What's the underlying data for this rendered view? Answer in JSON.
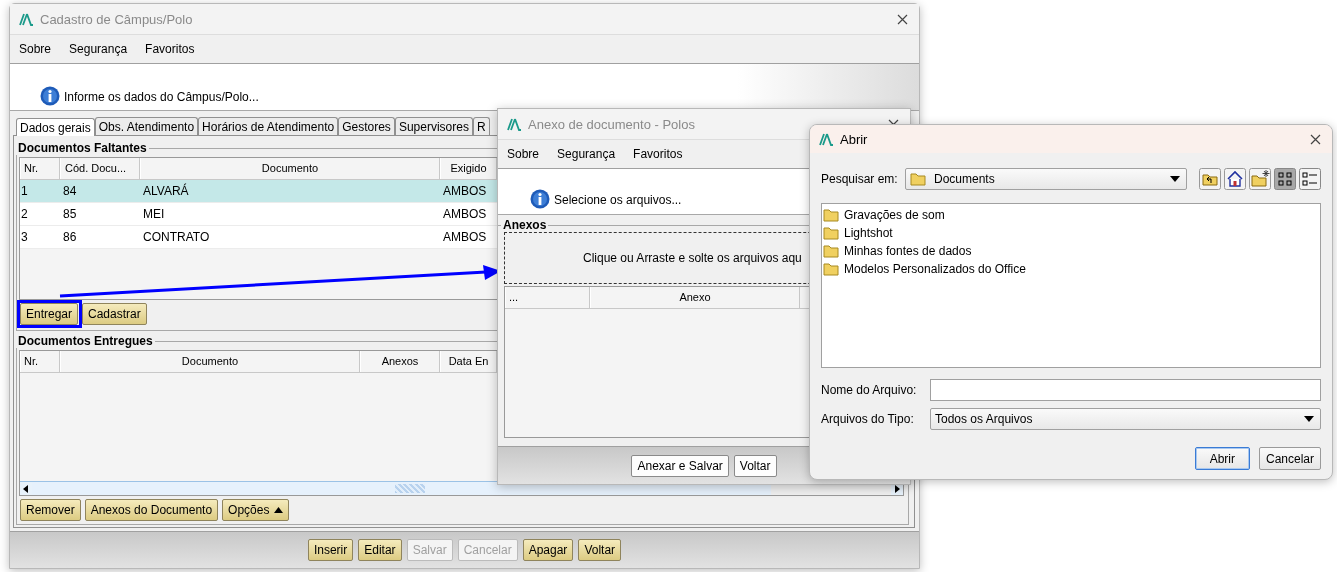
{
  "main_window": {
    "title": "Cadastro de Câmpus/Polo",
    "active": false,
    "menu": [
      "Sobre",
      "Segurança",
      "Favoritos"
    ],
    "info": "Informe os dados do Câmpus/Polo...",
    "tabs": [
      {
        "label": "Dados gerais",
        "selected": true
      },
      {
        "label": "Obs. Atendimento",
        "selected": false
      },
      {
        "label": "Horários de Atendimento",
        "selected": false
      },
      {
        "label": "Gestores",
        "selected": false
      },
      {
        "label": "Supervisores",
        "selected": false
      },
      {
        "label": "R",
        "selected": false
      }
    ],
    "missing_documents": {
      "title": "Documentos Faltantes",
      "columns": [
        "Nr.",
        "Cód. Docu...",
        "Documento",
        "Exigido"
      ],
      "rows": [
        {
          "cells": [
            "1",
            "84",
            "ALVARÁ",
            "AMBOS"
          ],
          "selected": true
        },
        {
          "cells": [
            "2",
            "85",
            "MEI",
            "AMBOS"
          ],
          "selected": false
        },
        {
          "cells": [
            "3",
            "86",
            "CONTRATO",
            "AMBOS"
          ],
          "selected": false
        }
      ],
      "buttons": [
        {
          "label": "Entregar",
          "highlighted": true
        },
        {
          "label": "Cadastrar",
          "highlighted": false
        }
      ]
    },
    "delivered_documents": {
      "title": "Documentos Entregues",
      "columns": [
        "Nr.",
        "Documento",
        "Anexos",
        "Data En"
      ],
      "buttons": [
        {
          "label": "Remover",
          "kind": "plain"
        },
        {
          "label": "Anexos do Documento",
          "kind": "plain"
        },
        {
          "label": "Opções",
          "kind": "menu"
        }
      ]
    },
    "footer_buttons": [
      {
        "label": "Inserir",
        "disabled": false
      },
      {
        "label": "Editar",
        "disabled": false
      },
      {
        "label": "Salvar",
        "disabled": true
      },
      {
        "label": "Cancelar",
        "disabled": true
      },
      {
        "label": "Apagar",
        "disabled": false
      },
      {
        "label": "Voltar",
        "disabled": false
      }
    ]
  },
  "attachment_window": {
    "title": "Anexo de documento - Polos",
    "active": false,
    "menu": [
      "Sobre",
      "Segurança",
      "Favoritos"
    ],
    "info": "Selecione os arquivos...",
    "group_title": "Anexos",
    "drop_zone": "Clique ou Arraste e solte os arquivos aqu",
    "columns": [
      "...",
      "Anexo"
    ],
    "buttons": [
      "Anexar e Salvar",
      "Voltar"
    ]
  },
  "open_dialog": {
    "title": "Abrir",
    "active": true,
    "look_in_label": "Pesquisar em:",
    "look_in": "Documents",
    "view_modes": [
      {
        "kind": "list",
        "selected": true
      },
      {
        "kind": "details",
        "selected": false
      }
    ],
    "files": [
      "Gravações de som",
      "Lightshot",
      "Minhas fontes de dados",
      "Modelos Personalizados do Office"
    ],
    "file_name_label": "Nome do Arquivo:",
    "file_type_label": "Arquivos do Tipo:",
    "file_type": "Todos os Arquivos",
    "buttons": [
      {
        "label": "Abrir",
        "default": true
      },
      {
        "label": "Cancelar",
        "default": false
      }
    ]
  }
}
